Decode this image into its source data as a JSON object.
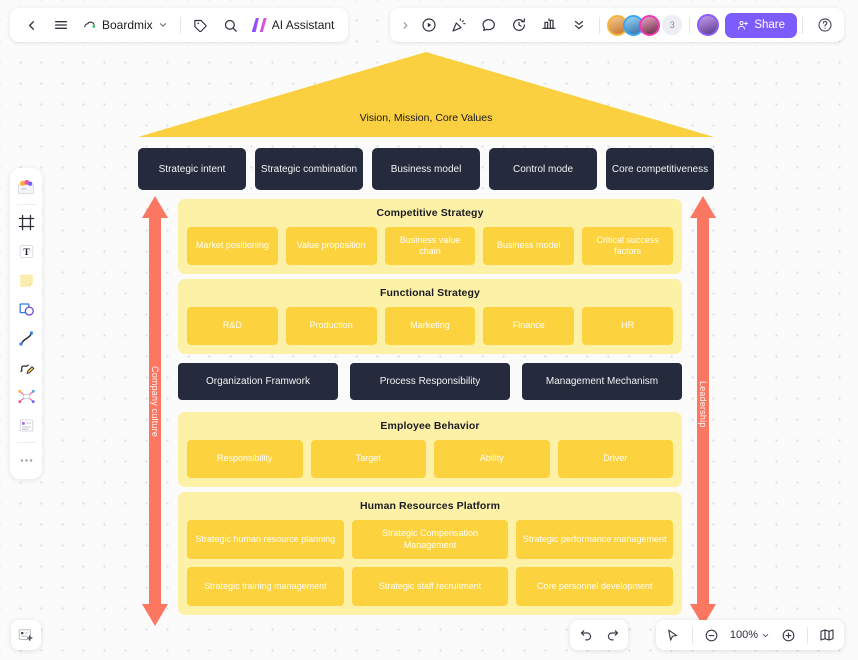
{
  "app": {
    "doc_title": "Boardmix",
    "ai_label": "AI Assistant",
    "share_label": "Share",
    "collaborator_count": "3",
    "zoom_level": "100%"
  },
  "topbar_left_icons": [
    {
      "name": "back-icon",
      "glyph": "back"
    },
    {
      "name": "menu-icon",
      "glyph": "menu"
    },
    {
      "name": "tag-icon",
      "glyph": "tag"
    },
    {
      "name": "search-icon",
      "glyph": "search"
    }
  ],
  "topbar_right_icons": [
    {
      "name": "expand-right-icon",
      "glyph": "chevron-right"
    },
    {
      "name": "record-icon",
      "glyph": "record"
    },
    {
      "name": "celebrate-icon",
      "glyph": "celebrate"
    },
    {
      "name": "comment-icon",
      "glyph": "comment"
    },
    {
      "name": "timer-icon",
      "glyph": "timer"
    },
    {
      "name": "present-icon",
      "glyph": "present"
    },
    {
      "name": "chevron-double-down-icon",
      "glyph": "chevrons-down"
    }
  ],
  "left_toolbar": [
    {
      "name": "template-icon",
      "label": "Templates"
    },
    {
      "name": "frame-icon",
      "label": "Frame"
    },
    {
      "name": "text-icon",
      "label": "Text"
    },
    {
      "name": "sticky-note-icon",
      "label": "Sticky note"
    },
    {
      "name": "shapes-icon",
      "label": "Shapes"
    },
    {
      "name": "connector-icon",
      "label": "Connector"
    },
    {
      "name": "pen-icon",
      "label": "Pen"
    },
    {
      "name": "mindmap-icon",
      "label": "Mind map"
    },
    {
      "name": "table-icon",
      "label": "Table"
    },
    {
      "name": "more-icon",
      "label": "More"
    }
  ],
  "bottom_bar": {
    "undo_label": "Undo",
    "redo_label": "Redo",
    "pointer_label": "Select",
    "zoom_out_label": "Zoom out",
    "zoom_in_label": "Zoom in",
    "minimap_label": "Minimap"
  },
  "diagram": {
    "roof_label": "Vision, Mission, Core Values",
    "strategy_pillars": [
      "Strategic intent",
      "Strategic combination",
      "Business model",
      "Control mode",
      "Core competitiveness"
    ],
    "competitive_strategy": {
      "title": "Competitive Strategy",
      "items": [
        "Market positioning",
        "Value proposition",
        "Business value chain",
        "Business model",
        "Critical success factors"
      ]
    },
    "functional_strategy": {
      "title": "Functional Strategy",
      "items": [
        "R&D",
        "Production",
        "Marketing",
        "Finance",
        "HR"
      ]
    },
    "organization_row": [
      "Organization Framwork",
      "Process Responsibility",
      "Management Mechanism"
    ],
    "employee_behavior": {
      "title": "Employee Behavior",
      "items": [
        "Responsibility",
        "Target",
        "Ability",
        "Driver"
      ]
    },
    "hr_platform": {
      "title": "Human Resources Platform",
      "row1": [
        "Strategic human resource planning",
        "Strategic Compensation Management",
        "Strategic performance management"
      ],
      "row2": [
        "Strategic training management",
        "Strategic staff recruitment",
        "Core personnel development"
      ]
    },
    "left_arrow_label": "Company culture",
    "right_arrow_label": "Leadership",
    "colors": {
      "roof": "#fbd040",
      "dark": "#252a3c",
      "panel_bg": "#fdf1a8",
      "card": "#fcd33f",
      "arrow": "#fb7762",
      "accent": "#7c5cfa"
    }
  }
}
